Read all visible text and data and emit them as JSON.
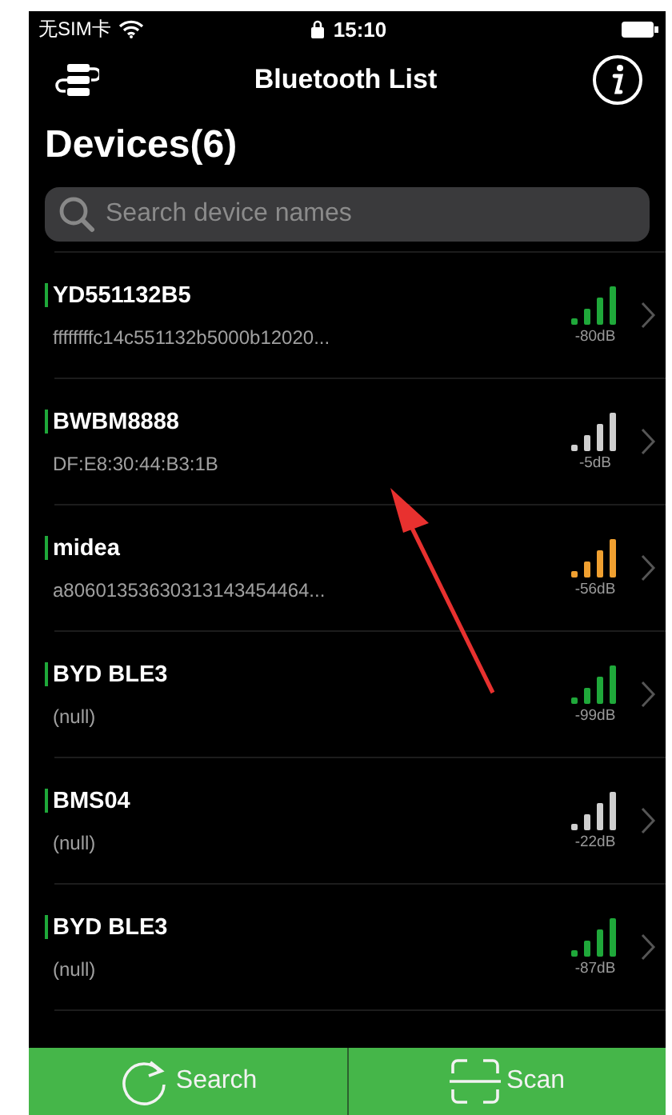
{
  "status_bar": {
    "carrier": "无SIM卡",
    "time": "15:10"
  },
  "nav_bar": {
    "title": "Bluetooth List"
  },
  "heading": "Devices(6)",
  "search": {
    "placeholder": "Search device names"
  },
  "devices": [
    {
      "name": "YD551132B5",
      "detail": "ffffffffc14c551132b5000b12020...",
      "reading": "-80dB",
      "color": "#1fa83a"
    },
    {
      "name": "BWBM8888",
      "detail": "DF:E8:30:44:B3:1B",
      "reading": "-5dB",
      "color": "#cfcfcf"
    },
    {
      "name": "midea",
      "detail": "a80601353630313143454464...",
      "reading": "-56dB",
      "color": "#f0a030"
    },
    {
      "name": "BYD BLE3",
      "detail": "(null)",
      "reading": "-99dB",
      "color": "#1fa83a"
    },
    {
      "name": "BMS04",
      "detail": "(null)",
      "reading": "-22dB",
      "color": "#cfcfcf"
    },
    {
      "name": "BYD BLE3",
      "detail": "(null)",
      "reading": "-87dB",
      "color": "#1fa83a"
    }
  ],
  "toolbar": [
    {
      "kind": "refresh",
      "label": "Search"
    },
    {
      "kind": "scan",
      "label": "Scan"
    }
  ]
}
